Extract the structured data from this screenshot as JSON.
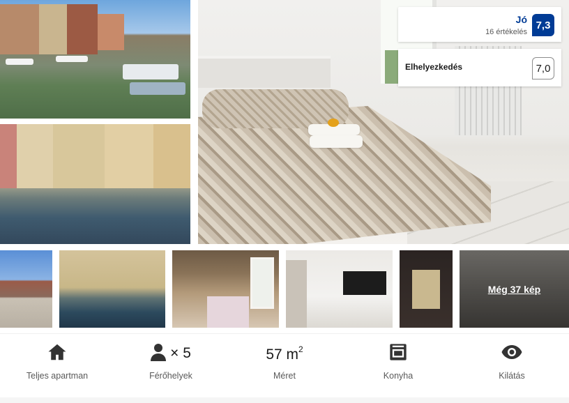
{
  "review": {
    "score_word": "Jó",
    "review_count": "16 értékelés",
    "score": "7,3",
    "sub_label": "Elhelyezkedés",
    "sub_score": "7,0"
  },
  "gallery": {
    "more_photos_label": "Még 37 kép"
  },
  "facilities": {
    "whole_apartment": {
      "icon": "house-icon",
      "label": "Teljes apartman"
    },
    "beds": {
      "icon": "person-icon",
      "value": "× 5",
      "label": "Férőhelyek"
    },
    "size": {
      "value": "57 m",
      "unit_sup": "2",
      "label": "Méret"
    },
    "kitchen": {
      "icon": "oven-icon",
      "label": "Konyha"
    },
    "view": {
      "icon": "eye-icon",
      "label": "Kilátás"
    }
  },
  "colors": {
    "brand_blue": "#003b95",
    "text_primary": "#1a1a1a",
    "text_secondary": "#595959"
  }
}
